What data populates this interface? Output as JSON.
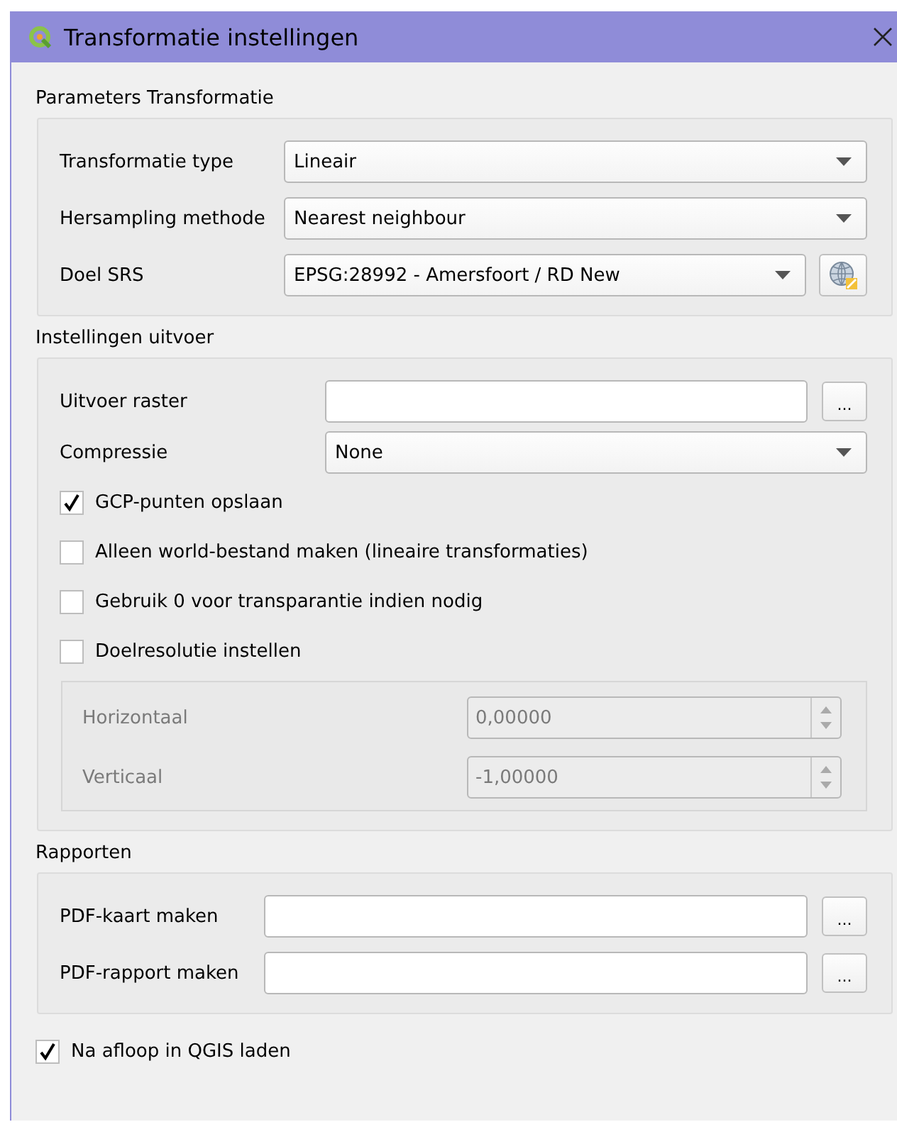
{
  "window": {
    "title": "Transformatie instellingen"
  },
  "sections": [
    {
      "title": "Parameters Transformatie",
      "rows": [
        {
          "kind": "dropdown",
          "label": "Transformatie type",
          "value": "Lineair"
        },
        {
          "kind": "dropdown",
          "label": "Hersampling methode",
          "value": "Nearest neighbour"
        },
        {
          "kind": "crs",
          "label": "Doel SRS",
          "value": "EPSG:28992 - Amersfoort / RD New"
        }
      ]
    },
    {
      "title": "Instellingen uitvoer",
      "rows": [
        {
          "kind": "file",
          "label": "Uitvoer raster",
          "button": "..."
        },
        {
          "kind": "dropdown",
          "label": "Compressie",
          "value": "None"
        },
        {
          "kind": "checkbox",
          "label": "GCP-punten opslaan",
          "checked": true
        },
        {
          "kind": "checkbox",
          "label": "Alleen world-bestand maken (lineaire transformaties)",
          "checked": false
        },
        {
          "kind": "checkbox",
          "label": "Gebruik 0 voor transparantie indien nodig",
          "checked": false
        },
        {
          "kind": "checkbox",
          "label": "Doelresolutie instellen",
          "checked": false
        },
        {
          "kind": "subgroup",
          "disabled": true,
          "fields": [
            {
              "label": "Horizontaal",
              "value": "0,00000"
            },
            {
              "label": "Verticaal",
              "value": "-1,00000"
            }
          ]
        }
      ]
    },
    {
      "title": "Rapporten",
      "rows": [
        {
          "kind": "file",
          "label": "PDF-kaart maken",
          "button": "..."
        },
        {
          "kind": "file",
          "label": "PDF-rapport maken",
          "button": "..."
        }
      ]
    }
  ],
  "footer_checkbox": {
    "label": "Na afloop in QGIS laden",
    "checked": true
  }
}
